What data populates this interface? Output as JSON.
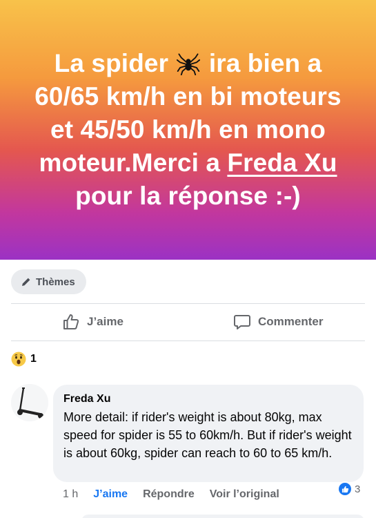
{
  "post": {
    "text_part1": "La spider",
    "text_part2": "ira bien a 60/65 km/h en bi moteurs et 45/50 km/h en mono moteur.Merci a",
    "mention": "Freda Xu",
    "text_part3": "pour la réponse :-)",
    "background_colors": [
      "#f8c24a",
      "#e4574f",
      "#9b32c4"
    ]
  },
  "toolbar": {
    "themes_label": "Thèmes",
    "like_label": "J’aime",
    "comment_label": "Commenter"
  },
  "reactions": {
    "icon": "wow-emoji",
    "count": "1"
  },
  "comment": {
    "author": "Freda Xu",
    "text": "More detail: if rider's weight is about 80kg, max speed for spider is 55 to 60km/h. But if rider's weight is about 60kg, spider can reach to 60 to 65 km/h.",
    "time": "1 h",
    "like_label": "J’aime",
    "reply_label": "Répondre",
    "see_original_label": "Voir l’original",
    "like_count": "3",
    "accent_color": "#1877f2"
  }
}
